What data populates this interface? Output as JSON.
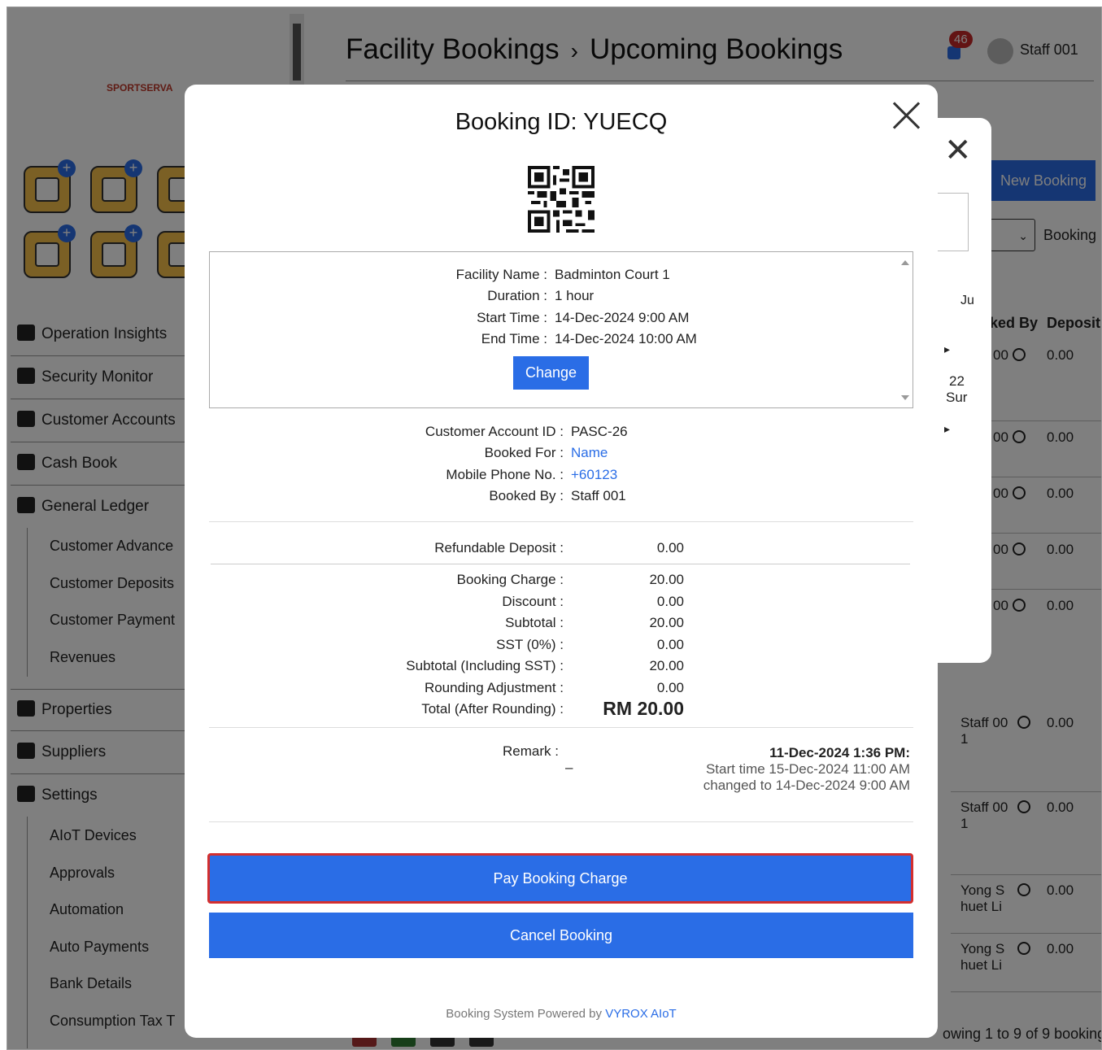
{
  "app": {
    "logo_text": "SPORTSERVA"
  },
  "header": {
    "title": "Facility Bookings",
    "separator": "›",
    "subtitle": "Upcoming Bookings",
    "notification_count": "46",
    "user_name": "Staff 001"
  },
  "sidebar": {
    "nav": [
      {
        "label": "Operation Insights"
      },
      {
        "label": "Security Monitor"
      },
      {
        "label": "Customer Accounts"
      },
      {
        "label": "Cash Book"
      },
      {
        "label": "General Ledger"
      }
    ],
    "ledger_sub": [
      "Customer Advance",
      "Customer Deposits",
      "Customer Payment",
      "Revenues"
    ],
    "nav2": [
      {
        "label": "Properties"
      },
      {
        "label": "Suppliers"
      },
      {
        "label": "Settings"
      }
    ],
    "settings_sub": [
      "AIoT Devices",
      "Approvals",
      "Automation",
      "Auto Payments",
      "Bank Details",
      "Consumption Tax T"
    ]
  },
  "background_table": {
    "new_booking_label": "New Booking",
    "booking_label": "Booking",
    "col_booked_by": "ked By",
    "col_deposit": "Deposit",
    "date_partial_1": "Ju",
    "date_partial_2": "22",
    "date_partial_3": "Sur",
    "rows": [
      {
        "booked_by": "00",
        "deposit": "0.00"
      },
      {
        "booked_by": "00",
        "deposit": "0.00"
      },
      {
        "booked_by": "00",
        "deposit": "0.00"
      },
      {
        "booked_by": "00",
        "deposit": "0.00"
      },
      {
        "booked_by": "00",
        "deposit": "0.00"
      },
      {
        "booked_by": "Staff 00 1",
        "deposit": "0.00"
      },
      {
        "booked_by": "Staff 00 1",
        "deposit": "0.00"
      },
      {
        "booked_by": "Yong S huet Li",
        "deposit": "0.00"
      },
      {
        "booked_by": "Yong S huet Li",
        "deposit": "0.00"
      }
    ],
    "footer": "owing 1 to 9 of 9 booking"
  },
  "modal": {
    "title": "Booking ID: YUECQ",
    "facility": {
      "facility_name_label": "Facility Name :",
      "facility_name": "Badminton Court 1",
      "duration_label": "Duration :",
      "duration": "1 hour",
      "start_label": "Start Time :",
      "start": "14-Dec-2024 9:00 AM",
      "end_label": "End Time :",
      "end": "14-Dec-2024 10:00 AM",
      "change_label": "Change"
    },
    "customer": {
      "account_label": "Customer Account ID :",
      "account": "PASC-26",
      "booked_for_label": "Booked For :",
      "booked_for": "Name",
      "phone_label": "Mobile Phone No. :",
      "phone": "+60123",
      "booked_by_label": "Booked By :",
      "booked_by": "Staff 001"
    },
    "charges": {
      "deposit_label": "Refundable Deposit :",
      "deposit": "0.00",
      "booking_charge_label": "Booking Charge :",
      "booking_charge": "20.00",
      "discount_label": "Discount :",
      "discount": "0.00",
      "subtotal_label": "Subtotal :",
      "subtotal": "20.00",
      "sst_label": "SST (0%) :",
      "sst": "0.00",
      "subtotal_sst_label": "Subtotal (Including SST) :",
      "subtotal_sst": "20.00",
      "rounding_label": "Rounding Adjustment :",
      "rounding": "0.00",
      "total_label": "Total (After Rounding) :",
      "total": "RM 20.00"
    },
    "remark": {
      "label": "Remark :",
      "value": "–",
      "log_date": "11-Dec-2024 1:36 PM:",
      "log_line1": "Start time 15-Dec-2024 11:00 AM",
      "log_line2": "changed to 14-Dec-2024 9:00 AM"
    },
    "pay_label": "Pay Booking Charge",
    "cancel_label": "Cancel Booking",
    "powered_prefix": "Booking System Powered by",
    "powered_brand": "VYROX AIoT"
  },
  "colors": {
    "accent": "#2a6de6",
    "highlight_border": "#d32f2f",
    "badge": "#c62828"
  }
}
